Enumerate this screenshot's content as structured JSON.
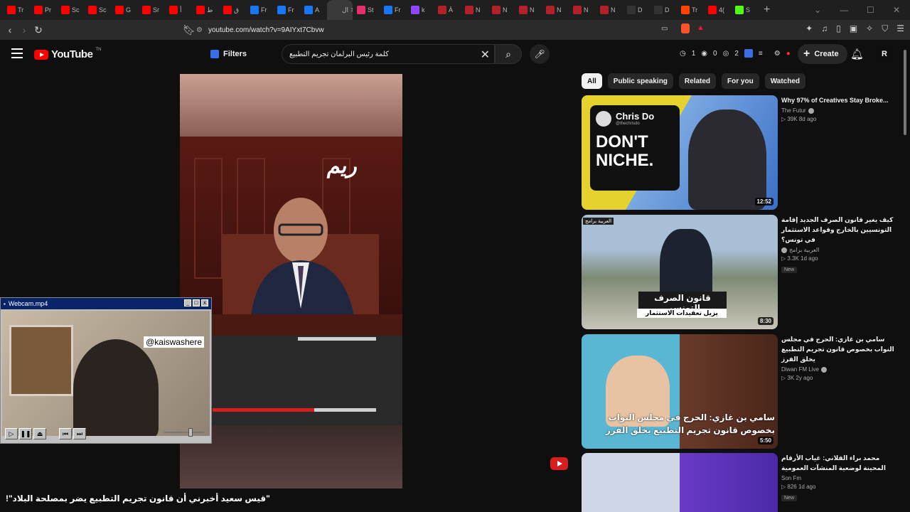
{
  "browser": {
    "tabs": [
      {
        "label": "Tr",
        "color": "#ff0000"
      },
      {
        "label": "Pr",
        "color": "#ff0000"
      },
      {
        "label": "Sc",
        "color": "#ff0000"
      },
      {
        "label": "Sc",
        "color": "#ff0000"
      },
      {
        "label": "G",
        "color": "#ff0000"
      },
      {
        "label": "Sr",
        "color": "#ff0000"
      },
      {
        "label": "أ",
        "color": "#ff0000"
      },
      {
        "label": "ط",
        "color": "#ff0000"
      },
      {
        "label": "ق",
        "color": "#ff0000"
      },
      {
        "label": "Fr",
        "color": "#1877f2"
      },
      {
        "label": "Fr",
        "color": "#1877f2"
      },
      {
        "label": "A",
        "color": "#1877f2"
      },
      {
        "label": "ال",
        "color": "#3a3a3a"
      },
      {
        "label": "St",
        "color": "#e1306c"
      },
      {
        "label": "Fr",
        "color": "#1877f2"
      },
      {
        "label": "k",
        "color": "#9146ff"
      },
      {
        "label": "À",
        "color": "#b3202a"
      },
      {
        "label": "N",
        "color": "#b3202a"
      },
      {
        "label": "N",
        "color": "#b3202a"
      },
      {
        "label": "N",
        "color": "#b3202a"
      },
      {
        "label": "N",
        "color": "#b3202a"
      },
      {
        "label": "N",
        "color": "#b3202a"
      },
      {
        "label": "N",
        "color": "#b3202a"
      },
      {
        "label": "D",
        "color": "#333333"
      },
      {
        "label": "D",
        "color": "#333333"
      },
      {
        "label": "Tr",
        "color": "#ff4500"
      },
      {
        "label": "4(",
        "color": "#ff0000"
      },
      {
        "label": "S",
        "color": "#53fc18"
      }
    ],
    "active_tab_index": 12,
    "url": "youtube.com/watch?v=9AIYxt7Cbvw"
  },
  "youtube": {
    "logo_text": "YouTube",
    "logo_sup": "TN",
    "filters_label": "Filters",
    "search_query": "كلمة رئيس البرلمان تجريم التطبيع",
    "ext_counters": [
      "1",
      "0",
      "2"
    ],
    "create_label": "Create",
    "avatar_letter": "R"
  },
  "player": {
    "channel_logo": "ريم",
    "progress": 0.62
  },
  "caption": "\"قيس سعيد أخبرني أن قانون تجريم التطبيع يضر بمصلحة البلاد\"!",
  "webcam": {
    "title": "Webcam.mp4",
    "handle": "@kaiswashere"
  },
  "chips": [
    {
      "label": "All",
      "active": true
    },
    {
      "label": "Public speaking",
      "active": false
    },
    {
      "label": "Related",
      "active": false
    },
    {
      "label": "For you",
      "active": false
    },
    {
      "label": "Watched",
      "active": false
    }
  ],
  "related": [
    {
      "title": "Why 97% of Creatives Stay Broke...",
      "channel": "The Futur",
      "stats": "▷ 39K   8d ago",
      "duration": "12:52",
      "thumb_name": "Chris Do",
      "thumb_handle": "@thechrisdo",
      "thumb_text": "DON'T NICHE.",
      "is_new": false,
      "new_label": ""
    },
    {
      "title": "كيف يغير قانون الصرف الجديد إقامة التونسيين بالخارج وقواعد الاستثمار في تونس؟",
      "channel": "العربية برامج",
      "stats": "▷ 3.3K   1d ago",
      "duration": "8:30",
      "thumb_text": "قانون الصرف التونسي",
      "thumb_text2": "يزيل تعقيدات الاستثمار",
      "thumb_channel": "العربية برامج",
      "is_new": true,
      "new_label": "New"
    },
    {
      "title": "سامي بن غازي: الحرج في مجلس النواب بخصوص قانون تجريم التطبيع يخلق الفرز",
      "channel": "Diwan FM Live",
      "stats": "▷ 3K   2y ago",
      "duration": "5:50",
      "thumb_text": "سامي بن غازي: الحرج في مجلس النواب بخصوص قانون تجريم التطبيع يخلق الفرز",
      "is_new": false,
      "new_label": ""
    },
    {
      "title": "محمد براء القلاني: غياب الأرقام المحينة لوضعية المنشآت العمومية",
      "channel": "Son Fm",
      "stats": "▷ 826   1d ago",
      "duration": "",
      "is_new": true,
      "new_label": "New"
    }
  ]
}
